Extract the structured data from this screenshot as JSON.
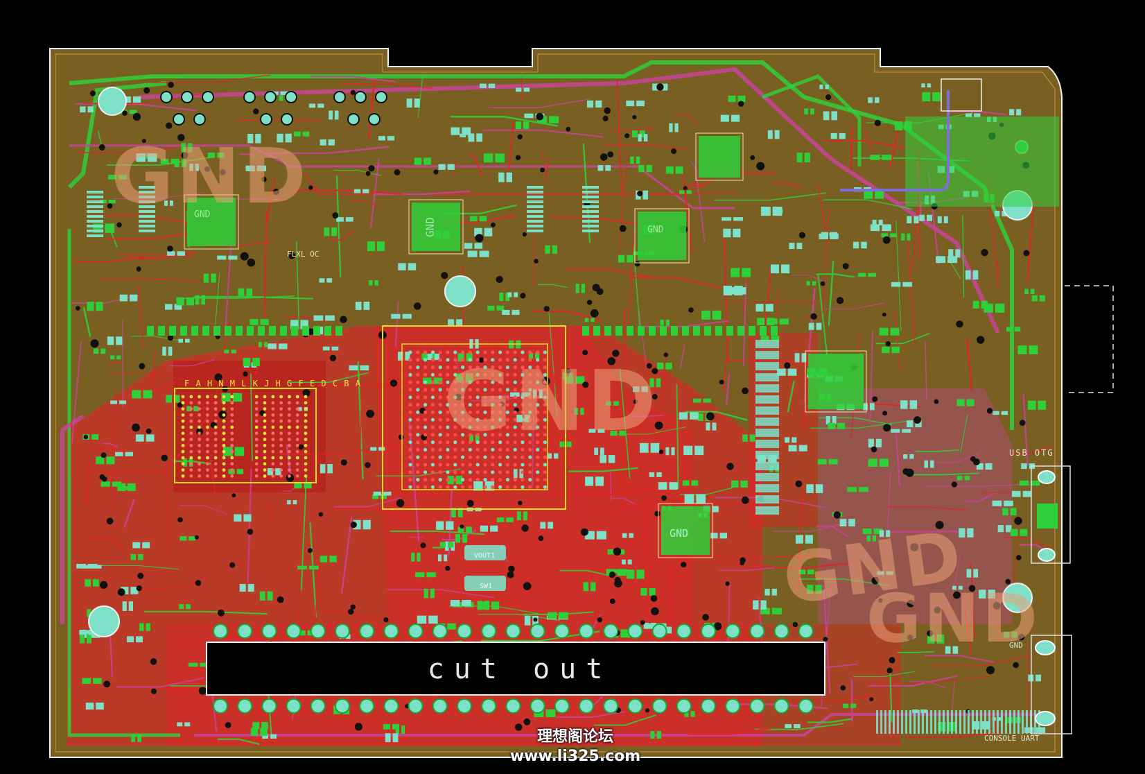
{
  "board": {
    "cutout_label": "cut out",
    "gnd_watermarks": [
      "GND",
      "GND",
      "GND",
      "GND"
    ],
    "pad_gnd_labels": [
      "GND",
      "GND",
      "GND",
      "GND",
      "GND"
    ],
    "silk_labels": {
      "usb_otg": "USB OTG",
      "console_uart": "CONSOLE UART",
      "fl": "FLXL OC",
      "vout": "VOUT1",
      "sw": "SW1",
      "ddr_cols": "F A H N M L K J H G   F E D C B  A"
    },
    "colors": {
      "background": "#000000",
      "board": "#7a5f22",
      "top_copper": "#e0242a",
      "bottom_copper": "#2fcf3a",
      "inner": "#c8449a",
      "pads": "#7fe0c8",
      "silkscreen": "#e8e8a0",
      "outline": "#f4f4f4"
    }
  },
  "watermark": {
    "line1": "理想阁论坛",
    "line2": "www.li325.com"
  }
}
